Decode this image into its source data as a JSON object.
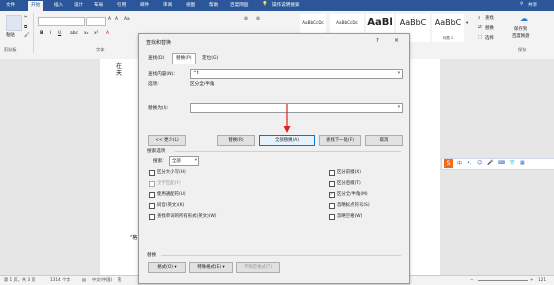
{
  "ribbon": {
    "tabs": [
      "文件",
      "开始",
      "插入",
      "设计",
      "布局",
      "引用",
      "邮件",
      "审阅",
      "视图",
      "帮助",
      "百度网盘"
    ],
    "tell_me": "操作说明搜索",
    "share": "共享",
    "paste_label": "粘贴",
    "clipboard_label": "剪贴板",
    "font_label": "字体",
    "paragraph_label": "段",
    "styles": [
      {
        "sample": "AaBbCcDc",
        "name": ""
      },
      {
        "sample": "AaBbCcDc",
        "name": ""
      },
      {
        "sample": "AaBl",
        "name": ""
      },
      {
        "sample": "AaBbC",
        "name": ""
      },
      {
        "sample": "AaBbC",
        "name": "标题 2"
      }
    ],
    "find_label": "查找",
    "replace_label": "替换",
    "select_label": "选择",
    "save_to_label": "保存到",
    "baidu_label": "百度网盘",
    "save_group": "保存"
  },
  "document": {
    "line1": "在",
    "line2": "天",
    "mark1": "\"格",
    "mark2": "\"格"
  },
  "statusbar": {
    "page": "第 1 页，共 3 页",
    "words": "1314 个字",
    "language": "中文(中国)",
    "zoom": "121"
  },
  "dialog": {
    "title": "查找和替换",
    "help": "?",
    "close": "×",
    "tabs": [
      "查找(D)",
      "替换(P)",
      "定位(G)"
    ],
    "find_label": "查找内容(N):",
    "find_value": "^t",
    "options_label": "选项:",
    "options_value": "区分全/半角",
    "replace_label": "替换为(I):",
    "replace_value": "",
    "buttons": {
      "less": "<< 更少(L)",
      "replace": "替换(R)",
      "replace_all": "全部替换(A)",
      "find_next": "查找下一处(F)",
      "cancel": "取消"
    },
    "search_options_label": "搜索选项",
    "search_label": "搜索:",
    "search_value": "全部",
    "checks_left": [
      {
        "label": "区分大小写(H)",
        "checked": false,
        "disabled": false
      },
      {
        "label": "全字匹配(Y)",
        "checked": false,
        "disabled": true
      },
      {
        "label": "使用通配符(U)",
        "checked": false,
        "disabled": false
      },
      {
        "label": "同音(英文)(K)",
        "checked": false,
        "disabled": false
      },
      {
        "label": "查找单词的所有形式(英文)(W)",
        "checked": false,
        "disabled": false
      }
    ],
    "checks_right": [
      {
        "label": "区分前缀(X)",
        "checked": false,
        "disabled": false
      },
      {
        "label": "区分后缀(T)",
        "checked": false,
        "disabled": false
      },
      {
        "label": "区分全/半角(M)",
        "checked": true,
        "disabled": false
      },
      {
        "label": "忽略标点符号(S)",
        "checked": false,
        "disabled": false
      },
      {
        "label": "忽略空格(W)",
        "checked": false,
        "disabled": false
      }
    ],
    "replace_section_label": "替换",
    "format_button": "格式(O) ▾",
    "special_button": "特殊格式(E) ▾",
    "no_format_button": "不限定格式(T)"
  },
  "colors": {
    "accent": "#2b579a",
    "arrow": "#e02020",
    "focus": "#0078d7"
  }
}
